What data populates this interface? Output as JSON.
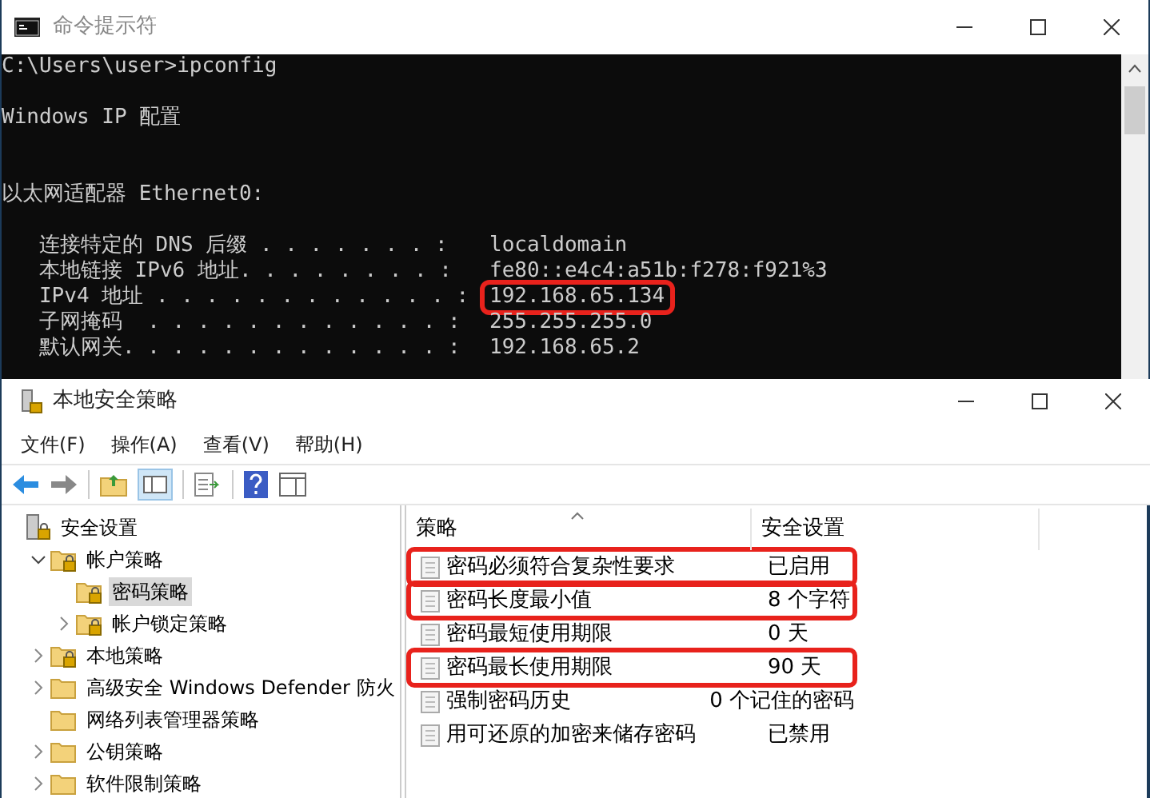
{
  "console_window": {
    "title": "命令提示符",
    "lines": [
      {
        "kind": "text",
        "text": "C:\\Users\\user>ipconfig"
      },
      {
        "kind": "blank"
      },
      {
        "kind": "text",
        "text": "Windows IP 配置"
      },
      {
        "kind": "blank"
      },
      {
        "kind": "blank"
      },
      {
        "kind": "text",
        "text": "以太网适配器 Ethernet0:"
      },
      {
        "kind": "blank"
      },
      {
        "kind": "entry",
        "label": "   连接特定的 DNS 后缀 . . . . . . . :",
        "value": "localdomain",
        "highlighted": false
      },
      {
        "kind": "entry",
        "label": "   本地链接 IPv6 地址. . . . . . . . :",
        "value": "fe80::e4c4:a51b:f278:f921%3",
        "highlighted": false
      },
      {
        "kind": "entry",
        "label": "   IPv4 地址 . . . . . . . . . . . . :",
        "value": "192.168.65.134",
        "highlighted": true
      },
      {
        "kind": "entry",
        "label": "   子网掩码  . . . . . . . . . . . . :",
        "value": "255.255.255.0",
        "highlighted": false
      },
      {
        "kind": "entry",
        "label": "   默认网关. . . . . . . . . . . . . :",
        "value": "192.168.65.2",
        "highlighted": false
      }
    ]
  },
  "policy_window": {
    "title": "本地安全策略",
    "menu": [
      "文件(F)",
      "操作(A)",
      "查看(V)",
      "帮助(H)"
    ],
    "tree": [
      {
        "label": "安全设置",
        "locked": true,
        "expandable": false,
        "selected": false,
        "children": [
          {
            "label": "帐户策略",
            "locked": true,
            "expandable": true,
            "expanded": true,
            "selected": false,
            "children": [
              {
                "label": "密码策略",
                "locked": true,
                "expandable": false,
                "selected": true
              },
              {
                "label": "帐户锁定策略",
                "locked": true,
                "expandable": true,
                "expanded": false,
                "selected": false
              }
            ]
          },
          {
            "label": "本地策略",
            "locked": true,
            "expandable": true,
            "expanded": false,
            "selected": false
          },
          {
            "label": "高级安全 Windows Defender 防火",
            "locked": false,
            "expandable": true,
            "expanded": false,
            "selected": false
          },
          {
            "label": "网络列表管理器策略",
            "locked": false,
            "expandable": false,
            "selected": false
          },
          {
            "label": "公钥策略",
            "locked": false,
            "expandable": true,
            "expanded": false,
            "selected": false
          },
          {
            "label": "软件限制策略",
            "locked": false,
            "expandable": true,
            "expanded": false,
            "selected": false
          }
        ]
      }
    ],
    "table": {
      "columns": [
        "策略",
        "安全设置"
      ],
      "rows": [
        {
          "policy": "密码必须符合复杂性要求",
          "setting": "已启用",
          "highlighted": true
        },
        {
          "policy": "密码长度最小值",
          "setting": "8 个字符",
          "highlighted": true
        },
        {
          "policy": "密码最短使用期限",
          "setting": "0 天",
          "highlighted": false
        },
        {
          "policy": "密码最长使用期限",
          "setting": "90 天",
          "highlighted": true
        },
        {
          "policy": "强制密码历史",
          "setting": "0 个记住的密码",
          "highlighted": false
        },
        {
          "policy": "用可还原的加密来储存密码",
          "setting": "已禁用",
          "highlighted": false
        }
      ]
    }
  }
}
